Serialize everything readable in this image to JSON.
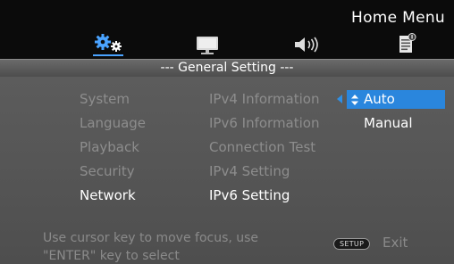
{
  "header": {
    "home_menu_title": "Home Menu",
    "section_title": "--- General Setting ---"
  },
  "top_icons": [
    {
      "name": "settings-gears-icon",
      "selected": true
    },
    {
      "name": "display-monitor-icon",
      "selected": false
    },
    {
      "name": "speaker-audio-icon",
      "selected": false
    },
    {
      "name": "info-document-icon",
      "selected": false
    }
  ],
  "categories": {
    "items": [
      "System",
      "Language",
      "Playback",
      "Security",
      "Network"
    ],
    "active": "Network"
  },
  "submenu": {
    "items": [
      "IPv4 Information",
      "IPv6 Information",
      "Connection Test",
      "IPv4 Setting",
      "IPv6 Setting"
    ],
    "active": "IPv6 Setting"
  },
  "options": {
    "items": [
      "Auto",
      "Manual"
    ],
    "selected": "Auto"
  },
  "footer": {
    "hint": "Use cursor key to move focus, use \"ENTER\" key to select",
    "setup_button": "SETUP",
    "exit_label": "Exit"
  },
  "colors": {
    "accent": "#2a86dd",
    "active_text": "#ffffff",
    "dim_text": "#8d8d8d",
    "panel_bg": "#555555",
    "top_bg": "#0b0b0b"
  }
}
